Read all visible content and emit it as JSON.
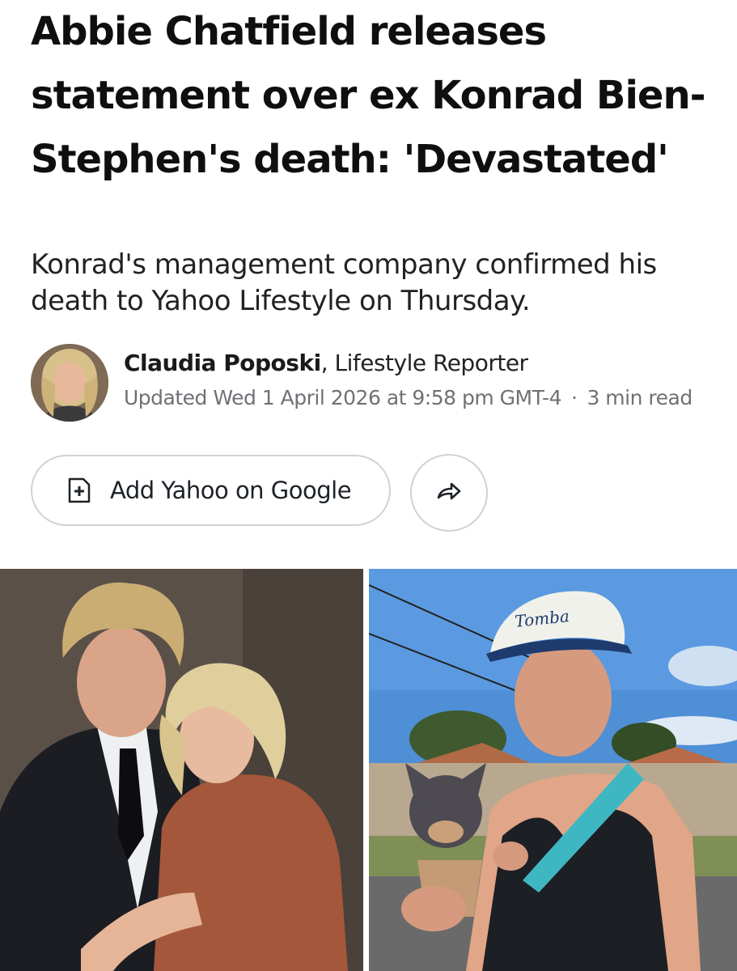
{
  "article": {
    "headline": "Abbie Chatfield releases statement over ex Konrad Bien-Stephen's death: 'Devastated'",
    "subheadline": "Konrad's management company confirmed his death to Yahoo Lifestyle on Thursday.",
    "author": {
      "name": "Claudia Poposki",
      "role": ", Lifestyle Reporter"
    },
    "updated": "Updated Wed 1 April 2026 at 9:58 pm GMT-4",
    "separator": "·",
    "read_time": "3 min read"
  },
  "actions": {
    "add_source_label": "Add Yahoo on Google",
    "add_source_icon": "add-document-icon",
    "share_icon": "share-arrow-icon"
  },
  "images": {
    "right_cap_text": "Tomba"
  },
  "colors": {
    "border": "#cfd2d6",
    "meta_text": "#6e7175",
    "accent_blue": "#1d2228"
  }
}
